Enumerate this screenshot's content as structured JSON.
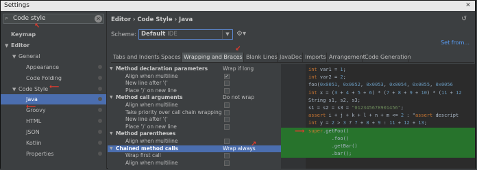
{
  "window": {
    "title": "Settings",
    "close_icon": "close-icon"
  },
  "sidebar": {
    "search_value": "Code style",
    "items": [
      {
        "label": "Keymap",
        "indent": 0,
        "bold": true
      },
      {
        "label": "Editor",
        "indent": 0,
        "bold": true,
        "arrow": "▼"
      },
      {
        "label": "General",
        "indent": 1,
        "arrow": "▼"
      },
      {
        "label": "Appearance",
        "indent": 2
      },
      {
        "label": "Code Folding",
        "indent": 2
      },
      {
        "label": "Code Style",
        "indent": 1,
        "arrow": "▼"
      },
      {
        "label": "Java",
        "indent": 2,
        "selected": true
      },
      {
        "label": "Groovy",
        "indent": 2
      },
      {
        "label": "HTML",
        "indent": 2
      },
      {
        "label": "JSON",
        "indent": 2
      },
      {
        "label": "Kotlin",
        "indent": 2
      },
      {
        "label": "Properties",
        "indent": 2
      }
    ]
  },
  "main": {
    "breadcrumb": "Editor  ›  Code Style  ›  Java",
    "scheme_label": "Scheme:",
    "scheme_name": "Default",
    "scheme_suffix": "IDE",
    "set_from": "Set from...",
    "tabs": [
      "Tabs and Indents",
      "Spaces",
      "Wrapping and Braces",
      "Blank Lines",
      "JavaDoc",
      "Imports",
      "Arrangement",
      "Code Generation"
    ],
    "active_tab": "Wrapping and Braces"
  },
  "options": [
    {
      "label": "Method declaration parameters",
      "group": true,
      "value": "Wrap if long"
    },
    {
      "label": "Align when multiline",
      "checkbox": true,
      "checked": true
    },
    {
      "label": "New line after '('",
      "checkbox": true,
      "checked": false
    },
    {
      "label": "Place ')' on new line",
      "checkbox": true,
      "checked": false
    },
    {
      "label": "Method call arguments",
      "group": true,
      "value": "Do not wrap"
    },
    {
      "label": "Align when multiline",
      "checkbox": true,
      "checked": false
    },
    {
      "label": "Take priority over call chain wrapping",
      "checkbox": true,
      "checked": false
    },
    {
      "label": "New line after '('",
      "checkbox": true,
      "checked": false
    },
    {
      "label": "Place ')' on new line",
      "checkbox": true,
      "checked": false
    },
    {
      "label": "Method parentheses",
      "group": true,
      "value": ""
    },
    {
      "label": "Align when multiline",
      "checkbox": true,
      "checked": false
    },
    {
      "label": "Chained method calls",
      "group": true,
      "value": "Wrap always",
      "selected": true
    },
    {
      "label": "Wrap first call",
      "checkbox": true,
      "checked": false
    },
    {
      "label": "Align when multiline",
      "checkbox": true,
      "checked": false
    }
  ],
  "code_lines": [
    "int var1 = 1;",
    "int var2 = 2;",
    "foo(0x0051, 0x0052, 0x0053, 0x0054, 0x0055, 0x0056",
    "int x = (3 + 4 + 5 + 6) * (7 + 8 + 9 + 10) * (11 + 12",
    "String s1, s2, s3;",
    "s1 = s2 = s3 = \"012345678901456\";",
    "assert i + j + k + l + n + m <= 2 : \"assert descript",
    "int y = 2 > 3 ? 7 + 8 + 9 : 11 + 12 + 13;",
    "super.getFoo()",
    "        .foo()",
    "        .getBar()",
    "        .bar();"
  ],
  "highlighted_lines": [
    8,
    9,
    10,
    11
  ],
  "colors": {
    "selection": "#4b6eaf",
    "highlight": "#27732c",
    "annotation": "#e23b2e"
  }
}
